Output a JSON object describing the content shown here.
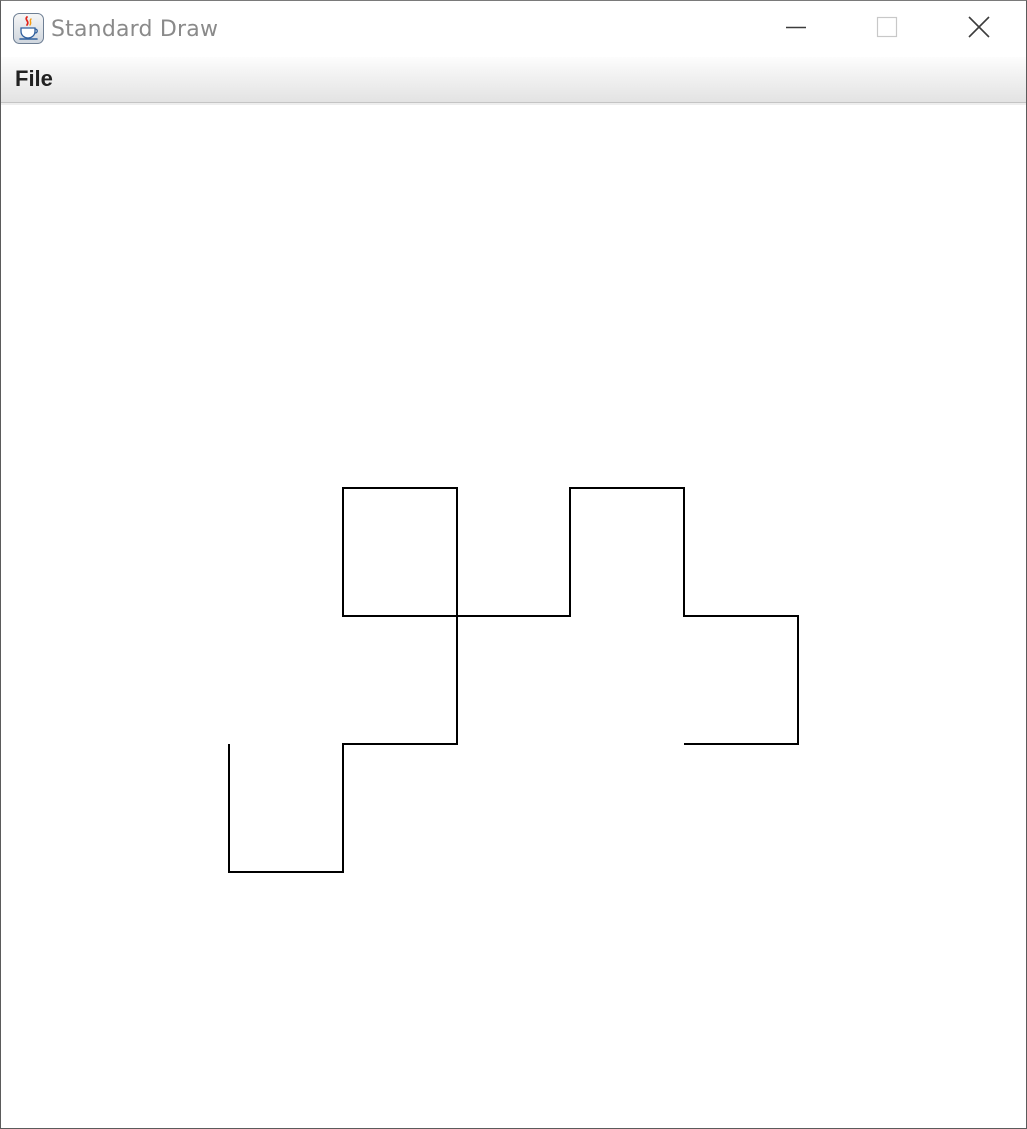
{
  "window": {
    "title": "Standard Draw",
    "icon": "java-coffee-cup-icon",
    "controls": [
      "minimize-icon",
      "maximize-icon",
      "close-icon"
    ]
  },
  "menubar": {
    "items": [
      {
        "label": "File"
      }
    ]
  },
  "canvas": {
    "background": "#ffffff",
    "stroke_color": "#000000",
    "drawing": "polyline path"
  }
}
